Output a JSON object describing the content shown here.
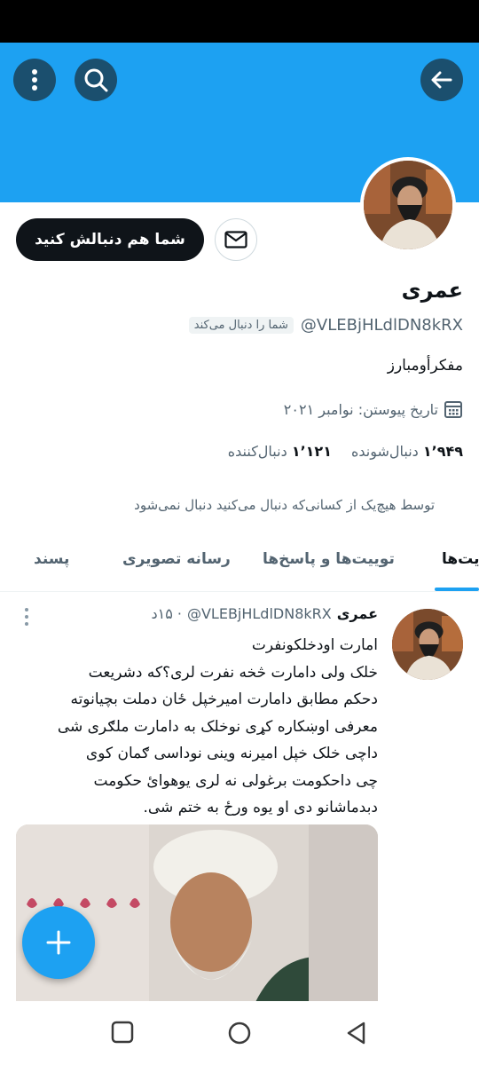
{
  "header": {
    "back_icon": "arrow-left-icon",
    "search_icon": "search-icon",
    "more_icon": "more-vertical-icon",
    "banner_color": "#1da1f2"
  },
  "profile": {
    "follow_button": "شما هم دنبالش کنید",
    "message_icon": "mail-icon",
    "name": "عمری",
    "handle": "@VLEBjHLdlDN8kRX",
    "follows_you": "شما را دنبال می‌کند",
    "bio": "مفکرأومبارز",
    "joined": "تاریخ پیوستن: نوامبر ۲۰۲۱",
    "following_count": "۱٬۹۴۹",
    "following_label": "دنبال‌شونده",
    "followers_count": "۱٬۱۲۱",
    "followers_label": "دنبال‌کننده",
    "not_followed_note": "توسط هیچ‌یک از کسانی‌که دنبال می‌کنید دنبال نمی‌شود"
  },
  "tabs": [
    {
      "label": "یت‌ها",
      "active": true
    },
    {
      "label": "توییت‌ها و پاسخ‌ها",
      "active": false
    },
    {
      "label": "رسانه تصویری",
      "active": false
    },
    {
      "label": "پسند",
      "active": false
    }
  ],
  "tweet": {
    "name": "عمری",
    "handle": "@VLEBjHLdlDN8kRX",
    "time": "· ۱۵د",
    "text": "امارت اودخلکونفرت\nخلک ولی دامارت څخه نفرت لری؟که دشریعت\nدحکم مطابق دامارت امیرخپل ځان دملت بچیانوته\nمعرفی اوښکاره کړی نوخلک به دامارت ملګری شی\nداچی خلک خپل امیرنه وینی نوداسی ګمان کوی\nچی داحکومت برغولی نه لری یوهوائ حکومت\nدبدماشانو دی او یوه ورځ به ختم شی."
  },
  "fab": {
    "icon": "plus-icon"
  },
  "navbar": {
    "recents_icon": "square-icon",
    "home_icon": "circle-icon",
    "back_icon": "triangle-back-icon"
  }
}
